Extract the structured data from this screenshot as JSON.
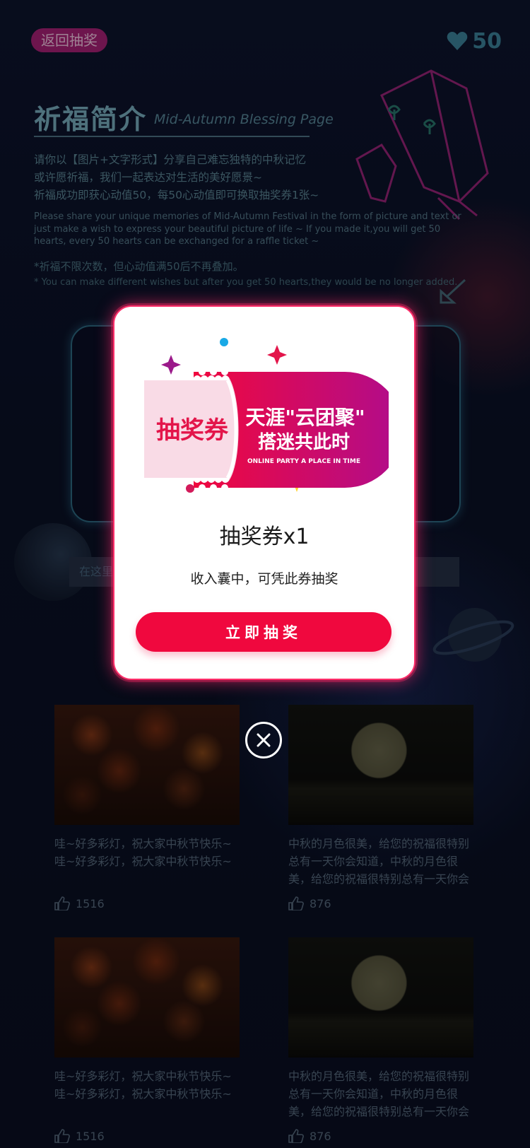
{
  "header": {
    "back_label": "返回抽奖",
    "hearts_count": "50"
  },
  "intro": {
    "title": "祈福简介",
    "subtitle": "Mid-Autumn Blessing Page",
    "desc_cn_1": "请你以【图片+文字形式】分享自己难忘独特的中秋记忆",
    "desc_cn_2": "或许愿祈福，我们一起表达对生活的美好愿景~",
    "desc_cn_3": "祈福成功即获心动值50，每50心动值即可换取抽奖券1张~",
    "desc_en": "Please share your unique memories of Mid-Autumn Festival in the form of picture and text or just make a wish to express your beautiful picture of life ~ If you made it,you will get 50 hearts, every 50 hearts can be exchanged for a raffle ticket ~",
    "note_cn": "*祈福不限次数，但心动值满50后不再叠加。",
    "note_en": "* You can make different wishes but after you get 50 hearts,they would be no longer added."
  },
  "input": {
    "placeholder": "在这里"
  },
  "posts": [
    {
      "caption": "哇~好多彩灯，祝大家中秋节快乐~哇~好多彩灯，祝大家中秋节快乐~",
      "likes": "1516"
    },
    {
      "caption": "中秋的月色很美，给您的祝福很特别总有一天你会知道，中秋的月色很美，给您的祝福很特别总有一天你会知....",
      "likes": "876"
    },
    {
      "caption": "哇~好多彩灯，祝大家中秋节快乐~哇~好多彩灯，祝大家中秋节快乐~",
      "likes": "1516"
    },
    {
      "caption": "中秋的月色很美，给您的祝福很特别总有一天你会知道，中秋的月色很美，给您的祝福很特别总有一天你会知....",
      "likes": "876"
    }
  ],
  "modal": {
    "ticket_label": "抽奖券",
    "brand_line_1": "天涯\"云团聚\"",
    "brand_line_2": "搭迷共此时",
    "brand_en": "ONLINE PARTY A PLACE IN TIME",
    "title": "抽奖券x1",
    "description": "收入囊中，可凭此券抽奖",
    "button_label": "立即抽奖"
  },
  "colors": {
    "accent": "#f0083e",
    "modal_glow": "#ff2e6a",
    "ticket_gradient_start": "#f0083e",
    "ticket_gradient_end": "#b00d8c",
    "ticket_stub": "#f9dbe6",
    "page_bg": "#0a0f22"
  },
  "icons": {
    "hearts": "heart-icon",
    "likes": "thumbs-up-icon",
    "close": "close-icon"
  }
}
